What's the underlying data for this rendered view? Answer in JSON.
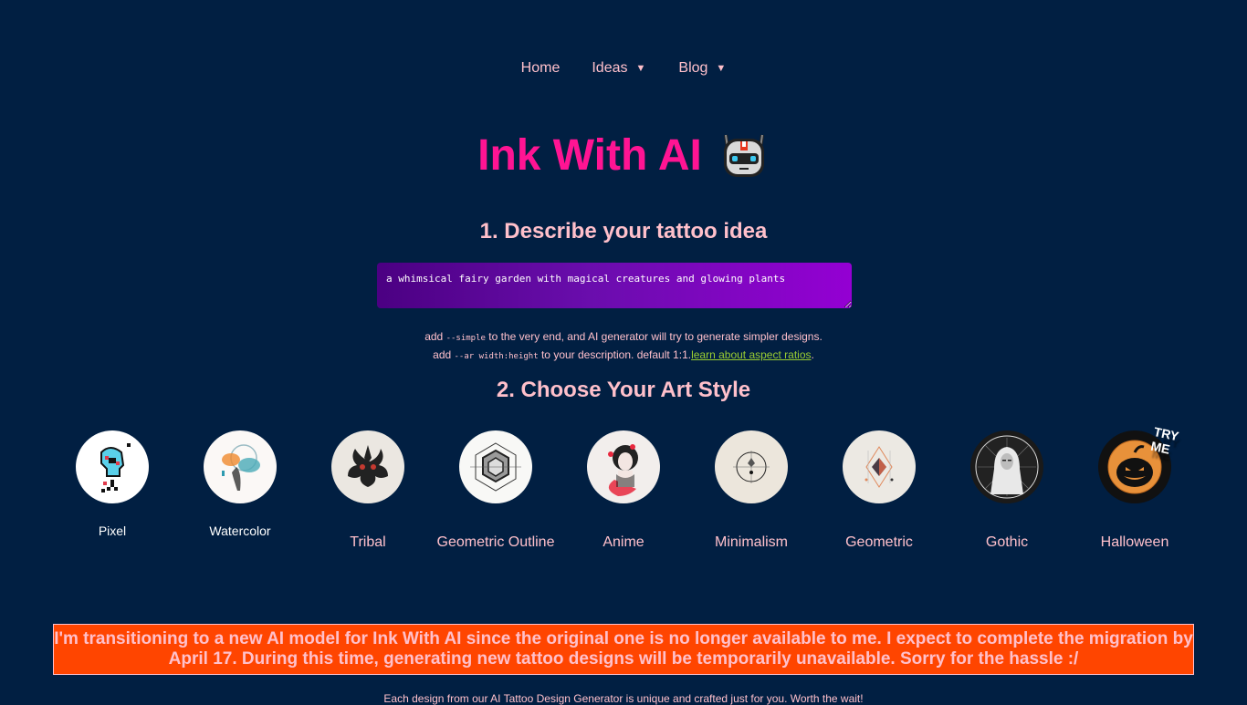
{
  "nav": {
    "items": [
      {
        "label": "Home",
        "dropdown": false
      },
      {
        "label": "Ideas",
        "dropdown": true
      },
      {
        "label": "Blog",
        "dropdown": true
      }
    ],
    "caret": "▼"
  },
  "header": {
    "title": "Ink With AI",
    "emoji_icon": "robot-icon",
    "title_color": "#ff1493"
  },
  "describe": {
    "heading": "1. Describe your tattoo idea",
    "prompt_value": "a whimsical fairy garden with magical creatures and glowing plants",
    "hint1_pre": "add ",
    "hint1_code": "--simple",
    "hint1_post": " to the very end, and AI generator will try to generate simpler designs.",
    "hint2_pre": "add ",
    "hint2_code": "--ar width:height",
    "hint2_post": " to your description. default 1:1.",
    "hint2_link": "learn about aspect ratios",
    "hint2_end": "."
  },
  "style": {
    "heading": "2. Choose Your Art Style",
    "items": [
      {
        "label": "Pixel",
        "icon": "pixel-skull-icon"
      },
      {
        "label": "Watercolor",
        "icon": "watercolor-splash-icon"
      },
      {
        "label": "Tribal",
        "icon": "tribal-mask-icon"
      },
      {
        "label": "Geometric Outline",
        "icon": "geometric-cube-icon"
      },
      {
        "label": "Anime",
        "icon": "anime-girl-icon"
      },
      {
        "label": "Minimalism",
        "icon": "minimal-circle-icon"
      },
      {
        "label": "Geometric",
        "icon": "geometric-diamond-icon"
      },
      {
        "label": "Gothic",
        "icon": "gothic-figure-icon"
      },
      {
        "label": "Halloween",
        "icon": "pumpkin-icon",
        "badge": "TRY ME"
      }
    ]
  },
  "banner": {
    "text": "I'm transitioning to a new AI model for Ink With AI since the original one is no longer available to me. I expect to complete the migration by April 17. During this time, generating new tattoo designs will be temporarily unavailable. Sorry for the hassle :/",
    "background": "#ff4500"
  },
  "footer_note": "Each design from our AI Tattoo Design Generator is unique and crafted just for you. Worth the wait!"
}
